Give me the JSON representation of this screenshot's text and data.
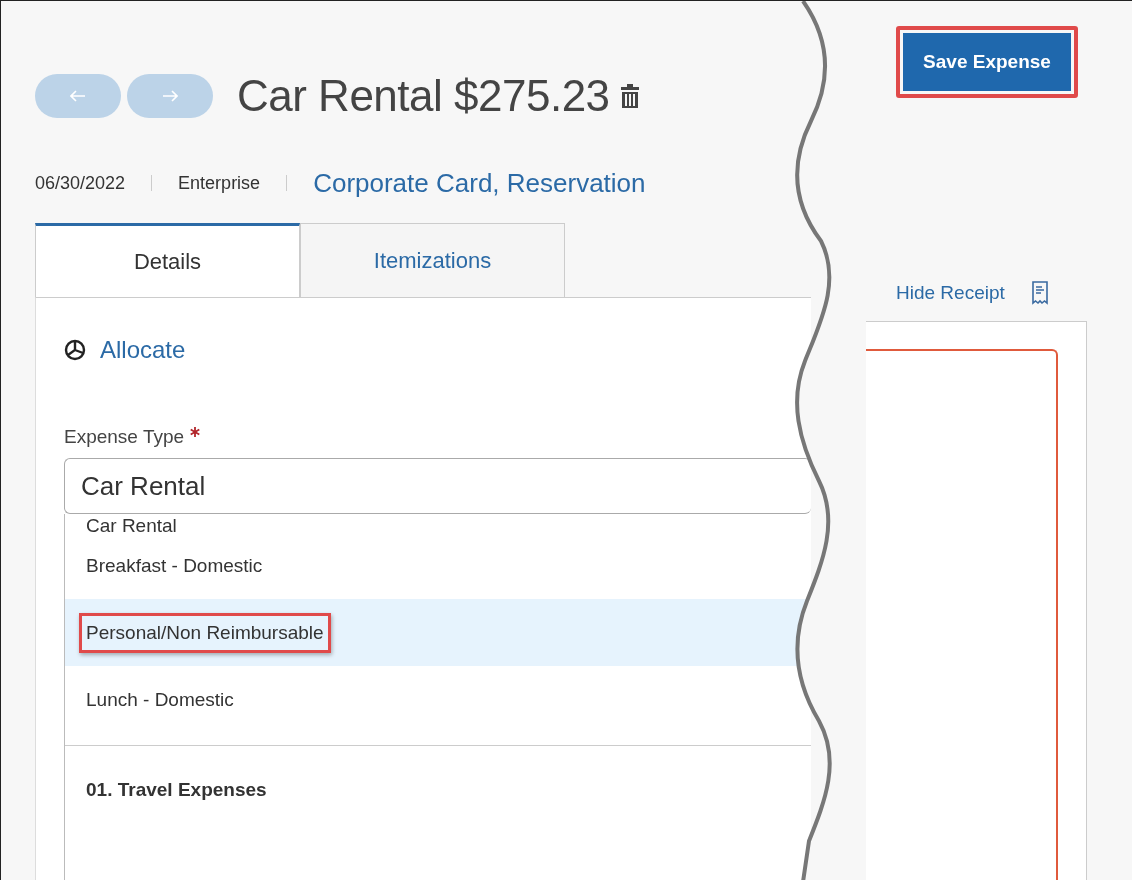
{
  "header": {
    "nav_buttons": [
      {
        "kind": "back",
        "disabled": true
      },
      {
        "kind": "forward",
        "disabled": true
      }
    ],
    "title": "Car Rental $275.23"
  },
  "meta": {
    "date": "06/30/2022",
    "vendor": "Enterprise",
    "payment": "Corporate Card, Reservation"
  },
  "tabs": [
    {
      "label": "Details",
      "selected": true
    },
    {
      "label": "Itemizations",
      "selected": false
    }
  ],
  "allocate": "Allocate",
  "expense_type": {
    "label": "Expense Type",
    "required": true,
    "value": "Car Rental"
  },
  "dropdown": [
    {
      "label": "Car Rental",
      "kind": "option",
      "selected": false,
      "highlighted": false
    },
    {
      "label": "Breakfast - Domestic",
      "kind": "option",
      "selected": false,
      "highlighted": false
    },
    {
      "label": "Personal/Non Reimbursable",
      "kind": "option",
      "selected": true,
      "highlighted": true
    },
    {
      "label": "Lunch - Domestic",
      "kind": "option",
      "selected": false,
      "highlighted": false
    },
    {
      "label": "01. Travel Expenses",
      "kind": "group",
      "selected": false,
      "highlighted": false
    }
  ],
  "save_button": {
    "label": "Save Expense",
    "highlighted": true
  },
  "receipt": {
    "toggle": "Hide Receipt"
  }
}
